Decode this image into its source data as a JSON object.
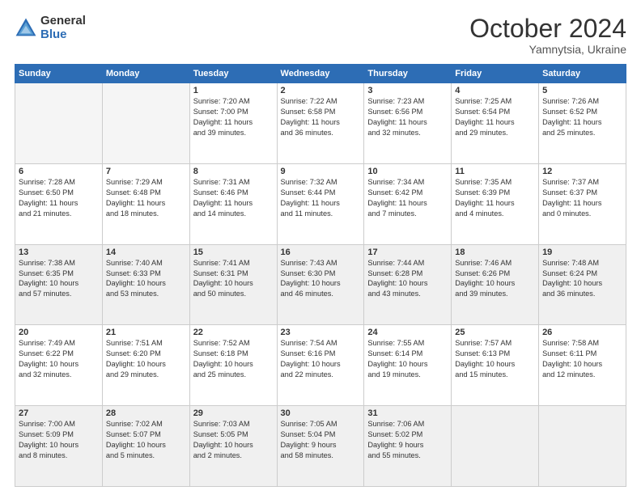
{
  "logo": {
    "general": "General",
    "blue": "Blue"
  },
  "header": {
    "month": "October 2024",
    "location": "Yamnytsia, Ukraine"
  },
  "weekdays": [
    "Sunday",
    "Monday",
    "Tuesday",
    "Wednesday",
    "Thursday",
    "Friday",
    "Saturday"
  ],
  "weeks": [
    [
      {
        "day": "",
        "info": ""
      },
      {
        "day": "",
        "info": ""
      },
      {
        "day": "1",
        "info": "Sunrise: 7:20 AM\nSunset: 7:00 PM\nDaylight: 11 hours\nand 39 minutes."
      },
      {
        "day": "2",
        "info": "Sunrise: 7:22 AM\nSunset: 6:58 PM\nDaylight: 11 hours\nand 36 minutes."
      },
      {
        "day": "3",
        "info": "Sunrise: 7:23 AM\nSunset: 6:56 PM\nDaylight: 11 hours\nand 32 minutes."
      },
      {
        "day": "4",
        "info": "Sunrise: 7:25 AM\nSunset: 6:54 PM\nDaylight: 11 hours\nand 29 minutes."
      },
      {
        "day": "5",
        "info": "Sunrise: 7:26 AM\nSunset: 6:52 PM\nDaylight: 11 hours\nand 25 minutes."
      }
    ],
    [
      {
        "day": "6",
        "info": "Sunrise: 7:28 AM\nSunset: 6:50 PM\nDaylight: 11 hours\nand 21 minutes."
      },
      {
        "day": "7",
        "info": "Sunrise: 7:29 AM\nSunset: 6:48 PM\nDaylight: 11 hours\nand 18 minutes."
      },
      {
        "day": "8",
        "info": "Sunrise: 7:31 AM\nSunset: 6:46 PM\nDaylight: 11 hours\nand 14 minutes."
      },
      {
        "day": "9",
        "info": "Sunrise: 7:32 AM\nSunset: 6:44 PM\nDaylight: 11 hours\nand 11 minutes."
      },
      {
        "day": "10",
        "info": "Sunrise: 7:34 AM\nSunset: 6:42 PM\nDaylight: 11 hours\nand 7 minutes."
      },
      {
        "day": "11",
        "info": "Sunrise: 7:35 AM\nSunset: 6:39 PM\nDaylight: 11 hours\nand 4 minutes."
      },
      {
        "day": "12",
        "info": "Sunrise: 7:37 AM\nSunset: 6:37 PM\nDaylight: 11 hours\nand 0 minutes."
      }
    ],
    [
      {
        "day": "13",
        "info": "Sunrise: 7:38 AM\nSunset: 6:35 PM\nDaylight: 10 hours\nand 57 minutes."
      },
      {
        "day": "14",
        "info": "Sunrise: 7:40 AM\nSunset: 6:33 PM\nDaylight: 10 hours\nand 53 minutes."
      },
      {
        "day": "15",
        "info": "Sunrise: 7:41 AM\nSunset: 6:31 PM\nDaylight: 10 hours\nand 50 minutes."
      },
      {
        "day": "16",
        "info": "Sunrise: 7:43 AM\nSunset: 6:30 PM\nDaylight: 10 hours\nand 46 minutes."
      },
      {
        "day": "17",
        "info": "Sunrise: 7:44 AM\nSunset: 6:28 PM\nDaylight: 10 hours\nand 43 minutes."
      },
      {
        "day": "18",
        "info": "Sunrise: 7:46 AM\nSunset: 6:26 PM\nDaylight: 10 hours\nand 39 minutes."
      },
      {
        "day": "19",
        "info": "Sunrise: 7:48 AM\nSunset: 6:24 PM\nDaylight: 10 hours\nand 36 minutes."
      }
    ],
    [
      {
        "day": "20",
        "info": "Sunrise: 7:49 AM\nSunset: 6:22 PM\nDaylight: 10 hours\nand 32 minutes."
      },
      {
        "day": "21",
        "info": "Sunrise: 7:51 AM\nSunset: 6:20 PM\nDaylight: 10 hours\nand 29 minutes."
      },
      {
        "day": "22",
        "info": "Sunrise: 7:52 AM\nSunset: 6:18 PM\nDaylight: 10 hours\nand 25 minutes."
      },
      {
        "day": "23",
        "info": "Sunrise: 7:54 AM\nSunset: 6:16 PM\nDaylight: 10 hours\nand 22 minutes."
      },
      {
        "day": "24",
        "info": "Sunrise: 7:55 AM\nSunset: 6:14 PM\nDaylight: 10 hours\nand 19 minutes."
      },
      {
        "day": "25",
        "info": "Sunrise: 7:57 AM\nSunset: 6:13 PM\nDaylight: 10 hours\nand 15 minutes."
      },
      {
        "day": "26",
        "info": "Sunrise: 7:58 AM\nSunset: 6:11 PM\nDaylight: 10 hours\nand 12 minutes."
      }
    ],
    [
      {
        "day": "27",
        "info": "Sunrise: 7:00 AM\nSunset: 5:09 PM\nDaylight: 10 hours\nand 8 minutes."
      },
      {
        "day": "28",
        "info": "Sunrise: 7:02 AM\nSunset: 5:07 PM\nDaylight: 10 hours\nand 5 minutes."
      },
      {
        "day": "29",
        "info": "Sunrise: 7:03 AM\nSunset: 5:05 PM\nDaylight: 10 hours\nand 2 minutes."
      },
      {
        "day": "30",
        "info": "Sunrise: 7:05 AM\nSunset: 5:04 PM\nDaylight: 9 hours\nand 58 minutes."
      },
      {
        "day": "31",
        "info": "Sunrise: 7:06 AM\nSunset: 5:02 PM\nDaylight: 9 hours\nand 55 minutes."
      },
      {
        "day": "",
        "info": ""
      },
      {
        "day": "",
        "info": ""
      }
    ]
  ]
}
